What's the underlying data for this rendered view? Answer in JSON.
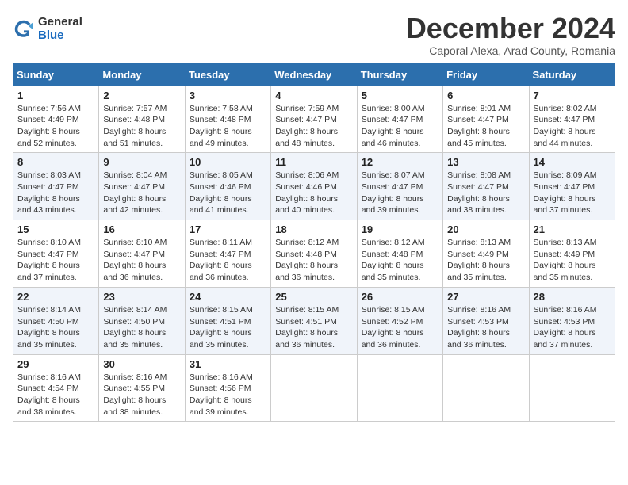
{
  "logo": {
    "general": "General",
    "blue": "Blue"
  },
  "header": {
    "month": "December 2024",
    "location": "Caporal Alexa, Arad County, Romania"
  },
  "weekdays": [
    "Sunday",
    "Monday",
    "Tuesday",
    "Wednesday",
    "Thursday",
    "Friday",
    "Saturday"
  ],
  "weeks": [
    [
      {
        "day": "1",
        "sunrise": "7:56 AM",
        "sunset": "4:49 PM",
        "daylight": "8 hours and 52 minutes."
      },
      {
        "day": "2",
        "sunrise": "7:57 AM",
        "sunset": "4:48 PM",
        "daylight": "8 hours and 51 minutes."
      },
      {
        "day": "3",
        "sunrise": "7:58 AM",
        "sunset": "4:48 PM",
        "daylight": "8 hours and 49 minutes."
      },
      {
        "day": "4",
        "sunrise": "7:59 AM",
        "sunset": "4:47 PM",
        "daylight": "8 hours and 48 minutes."
      },
      {
        "day": "5",
        "sunrise": "8:00 AM",
        "sunset": "4:47 PM",
        "daylight": "8 hours and 46 minutes."
      },
      {
        "day": "6",
        "sunrise": "8:01 AM",
        "sunset": "4:47 PM",
        "daylight": "8 hours and 45 minutes."
      },
      {
        "day": "7",
        "sunrise": "8:02 AM",
        "sunset": "4:47 PM",
        "daylight": "8 hours and 44 minutes."
      }
    ],
    [
      {
        "day": "8",
        "sunrise": "8:03 AM",
        "sunset": "4:47 PM",
        "daylight": "8 hours and 43 minutes."
      },
      {
        "day": "9",
        "sunrise": "8:04 AM",
        "sunset": "4:47 PM",
        "daylight": "8 hours and 42 minutes."
      },
      {
        "day": "10",
        "sunrise": "8:05 AM",
        "sunset": "4:46 PM",
        "daylight": "8 hours and 41 minutes."
      },
      {
        "day": "11",
        "sunrise": "8:06 AM",
        "sunset": "4:46 PM",
        "daylight": "8 hours and 40 minutes."
      },
      {
        "day": "12",
        "sunrise": "8:07 AM",
        "sunset": "4:47 PM",
        "daylight": "8 hours and 39 minutes."
      },
      {
        "day": "13",
        "sunrise": "8:08 AM",
        "sunset": "4:47 PM",
        "daylight": "8 hours and 38 minutes."
      },
      {
        "day": "14",
        "sunrise": "8:09 AM",
        "sunset": "4:47 PM",
        "daylight": "8 hours and 37 minutes."
      }
    ],
    [
      {
        "day": "15",
        "sunrise": "8:10 AM",
        "sunset": "4:47 PM",
        "daylight": "8 hours and 37 minutes."
      },
      {
        "day": "16",
        "sunrise": "8:10 AM",
        "sunset": "4:47 PM",
        "daylight": "8 hours and 36 minutes."
      },
      {
        "day": "17",
        "sunrise": "8:11 AM",
        "sunset": "4:47 PM",
        "daylight": "8 hours and 36 minutes."
      },
      {
        "day": "18",
        "sunrise": "8:12 AM",
        "sunset": "4:48 PM",
        "daylight": "8 hours and 36 minutes."
      },
      {
        "day": "19",
        "sunrise": "8:12 AM",
        "sunset": "4:48 PM",
        "daylight": "8 hours and 35 minutes."
      },
      {
        "day": "20",
        "sunrise": "8:13 AM",
        "sunset": "4:49 PM",
        "daylight": "8 hours and 35 minutes."
      },
      {
        "day": "21",
        "sunrise": "8:13 AM",
        "sunset": "4:49 PM",
        "daylight": "8 hours and 35 minutes."
      }
    ],
    [
      {
        "day": "22",
        "sunrise": "8:14 AM",
        "sunset": "4:50 PM",
        "daylight": "8 hours and 35 minutes."
      },
      {
        "day": "23",
        "sunrise": "8:14 AM",
        "sunset": "4:50 PM",
        "daylight": "8 hours and 35 minutes."
      },
      {
        "day": "24",
        "sunrise": "8:15 AM",
        "sunset": "4:51 PM",
        "daylight": "8 hours and 35 minutes."
      },
      {
        "day": "25",
        "sunrise": "8:15 AM",
        "sunset": "4:51 PM",
        "daylight": "8 hours and 36 minutes."
      },
      {
        "day": "26",
        "sunrise": "8:15 AM",
        "sunset": "4:52 PM",
        "daylight": "8 hours and 36 minutes."
      },
      {
        "day": "27",
        "sunrise": "8:16 AM",
        "sunset": "4:53 PM",
        "daylight": "8 hours and 36 minutes."
      },
      {
        "day": "28",
        "sunrise": "8:16 AM",
        "sunset": "4:53 PM",
        "daylight": "8 hours and 37 minutes."
      }
    ],
    [
      {
        "day": "29",
        "sunrise": "8:16 AM",
        "sunset": "4:54 PM",
        "daylight": "8 hours and 38 minutes."
      },
      {
        "day": "30",
        "sunrise": "8:16 AM",
        "sunset": "4:55 PM",
        "daylight": "8 hours and 38 minutes."
      },
      {
        "day": "31",
        "sunrise": "8:16 AM",
        "sunset": "4:56 PM",
        "daylight": "8 hours and 39 minutes."
      },
      null,
      null,
      null,
      null
    ]
  ],
  "labels": {
    "sunrise_prefix": "Sunrise: ",
    "sunset_prefix": "Sunset: ",
    "daylight_prefix": "Daylight: "
  }
}
